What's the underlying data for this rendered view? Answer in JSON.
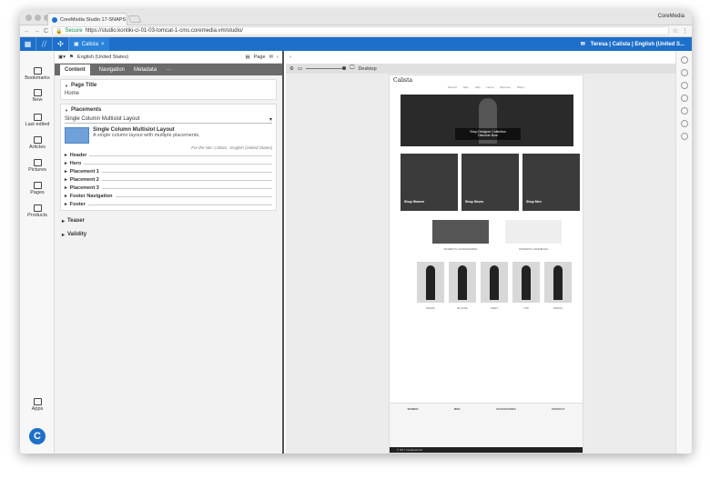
{
  "browser": {
    "tab_title": "CoreMedia Studio 17-SNAPS",
    "tab_close": "×",
    "user_label": "CoreMedia",
    "secure_label": "Secure",
    "url": "https://studio.kontiki-ci-01-03-tomcat-1-cms.coremedia.vm/studio/"
  },
  "appbar": {
    "doc_tab": "Calista",
    "doc_tab_close": "×",
    "user": "Teresa | Calista | English (United S..."
  },
  "leftnav": {
    "items": [
      "Bookmarks",
      "New",
      "Last edited",
      "Articles",
      "Pictures",
      "Pages",
      "Products"
    ],
    "apps": "Apps"
  },
  "editor": {
    "locale": "English (United States)",
    "page_label": "Page",
    "tabs": [
      "Content",
      "Navigation",
      "Metadata",
      "···"
    ],
    "page_title_heading": "Page Title",
    "page_title_value": "Home",
    "placements_heading": "Placements",
    "layout_select": "Single Column Multislot Layout",
    "layout_name": "Single Column Multislot Layout",
    "layout_desc": "A single column layout with multiple placements.",
    "for_site": "For the site: Calista - English (United States)",
    "placements": [
      "Header",
      "Hero",
      "Placement 1",
      "Placement 2",
      "Placement 3",
      "Footer Navigation",
      "Footer"
    ],
    "collapsed": [
      "Teaser",
      "Validity"
    ]
  },
  "preview": {
    "device": "Desktop",
    "site": {
      "brand": "Calista",
      "nav": "Women Men Kids Home Discover Offers",
      "hero_title": "Shop Designer Collection",
      "hero_sub": "Discover Now",
      "tiles": [
        "Shop Women",
        "Shop Shoes",
        "Shop Men"
      ],
      "promo": [
        "WOMEN'S ACCESSORIES",
        "WOMEN'S HANDBAGS"
      ],
      "products": [
        "DRESS",
        "BLOUSE",
        "SKIRT",
        "TOP",
        "DRESS"
      ],
      "footer_cols": [
        "WOMEN",
        "MEN",
        "ACCESSORIES",
        "CONTACT"
      ],
      "copyright": "© 2017 CoreMedia AG"
    }
  }
}
